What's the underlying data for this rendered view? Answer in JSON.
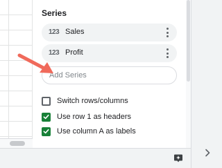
{
  "series_section": {
    "title": "Series",
    "items": [
      {
        "type_icon": "123",
        "label": "Sales",
        "menu_icon": "more-vert-icon"
      },
      {
        "type_icon": "123",
        "label": "Profit",
        "menu_icon": "more-vert-icon"
      }
    ],
    "add_series_placeholder": "Add Series"
  },
  "options": [
    {
      "label": "Switch rows/columns",
      "checked": false
    },
    {
      "label": "Use row 1 as headers",
      "checked": true
    },
    {
      "label": "Use column A as labels",
      "checked": true
    }
  ],
  "footer": {
    "explore_icon": "explore-icon",
    "side_panel_icon": "chevron-right-icon"
  },
  "colors": {
    "checkbox_checked": "#188038",
    "chip_background": "#f1f3f4",
    "annotation_arrow": "#f06a5b"
  }
}
